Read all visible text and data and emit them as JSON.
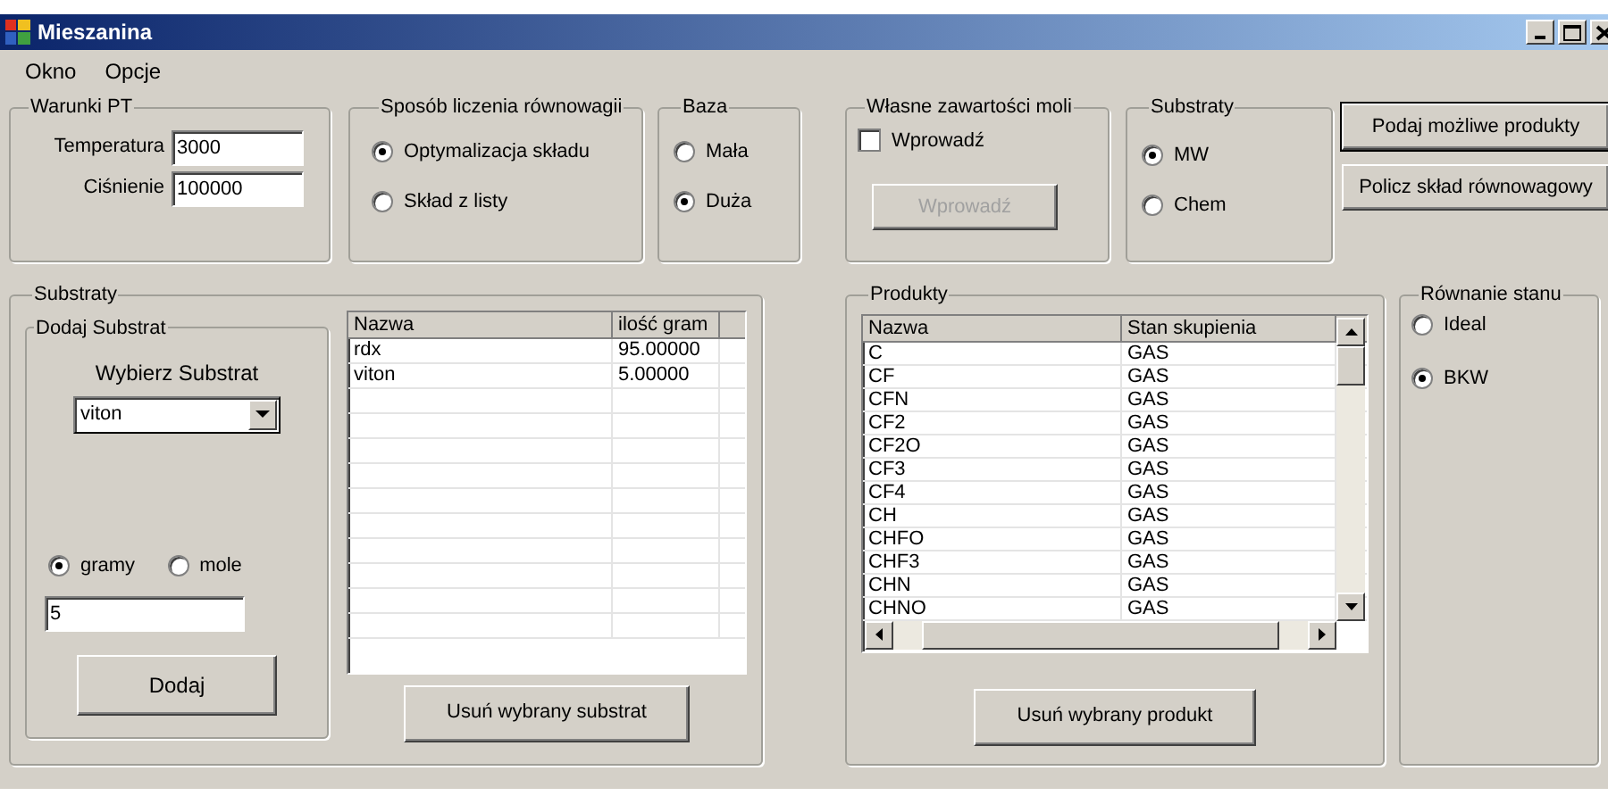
{
  "window": {
    "title": "Mieszanina"
  },
  "menu": [
    "Okno",
    "Opcje"
  ],
  "pt": {
    "title": "Warunki PT",
    "fields": [
      {
        "label": "Temperatura",
        "value": "3000"
      },
      {
        "label": "Ciśnienie",
        "value": "100000"
      }
    ]
  },
  "method": {
    "title": "Sposób liczenia równowagii",
    "options": [
      {
        "label": "Optymalizacja składu",
        "selected": true
      },
      {
        "label": "Skład z listy",
        "selected": false
      }
    ]
  },
  "base": {
    "title": "Baza",
    "options": [
      {
        "label": "Mała",
        "selected": false
      },
      {
        "label": "Duża",
        "selected": true
      }
    ]
  },
  "moles": {
    "title": "Własne zawartości moli",
    "checkbox": {
      "label": "Wprowadź",
      "checked": false
    },
    "button": {
      "label": "Wprowadź",
      "disabled": true
    }
  },
  "substrate_source": {
    "title": "Substraty",
    "options": [
      {
        "label": "MW",
        "selected": true
      },
      {
        "label": "Chem",
        "selected": false
      }
    ]
  },
  "actions": [
    {
      "label": "Podaj możliwe produkty",
      "focused": true
    },
    {
      "label": "Policz skład równowagowy",
      "focused": false
    }
  ],
  "substrates": {
    "title": "Substraty",
    "add": {
      "title": "Dodaj Substrat",
      "select_label": "Wybierz Substrat",
      "select_value": "viton",
      "units": [
        {
          "label": "gramy",
          "selected": true
        },
        {
          "label": "mole",
          "selected": false
        }
      ],
      "amount": "5",
      "button": "Dodaj"
    },
    "table": {
      "columns": [
        "Nazwa",
        "ilość gram"
      ],
      "rows": [
        [
          "rdx",
          "95.00000"
        ],
        [
          "viton",
          "5.00000"
        ]
      ]
    },
    "remove_button": "Usuń wybrany substrat"
  },
  "products": {
    "title": "Produkty",
    "table": {
      "columns": [
        "Nazwa",
        "Stan skupienia"
      ],
      "rows": [
        [
          "C",
          "GAS"
        ],
        [
          "CF",
          "GAS"
        ],
        [
          "CFN",
          "GAS"
        ],
        [
          "CF2",
          "GAS"
        ],
        [
          "CF2O",
          "GAS"
        ],
        [
          "CF3",
          "GAS"
        ],
        [
          "CF4",
          "GAS"
        ],
        [
          "CH",
          "GAS"
        ],
        [
          "CHFO",
          "GAS"
        ],
        [
          "CHF3",
          "GAS"
        ],
        [
          "CHN",
          "GAS"
        ],
        [
          "CHNO",
          "GAS"
        ]
      ]
    },
    "remove_button": "Usuń wybrany produkt"
  },
  "equation": {
    "title": "Równanie stanu",
    "options": [
      {
        "label": "Ideal",
        "selected": false
      },
      {
        "label": "BKW",
        "selected": true
      }
    ]
  }
}
